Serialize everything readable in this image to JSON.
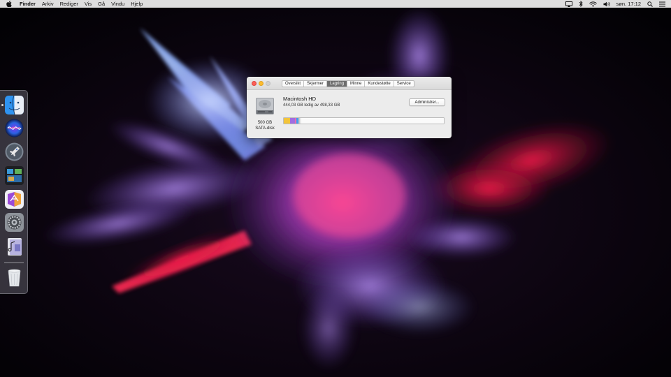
{
  "menubar": {
    "app_name": "Finder",
    "menus": [
      "Arkiv",
      "Rediger",
      "Vis",
      "Gå",
      "Vindu",
      "Hjelp"
    ],
    "clock": "søn. 17:12",
    "status_icons": [
      "airplay-icon",
      "bluetooth-icon",
      "wifi-icon",
      "volume-icon",
      "search-icon",
      "menu-list-icon"
    ]
  },
  "window": {
    "tabs": [
      {
        "label": "Oversikt",
        "active": false
      },
      {
        "label": "Skjermer",
        "active": false
      },
      {
        "label": "Lagring",
        "active": true
      },
      {
        "label": "Minne",
        "active": false
      },
      {
        "label": "Kundestøtte",
        "active": false
      },
      {
        "label": "Service",
        "active": false
      }
    ],
    "disk": {
      "size": "500 GB",
      "type": "SATA-disk"
    },
    "volume": {
      "name": "Macintosh HD",
      "free_text": "444,03 GB ledig av 498,33 GB",
      "used_fraction": 0.109
    },
    "manage_label": "Administrer..."
  },
  "dock": {
    "apps": [
      "finder-icon",
      "siri-icon",
      "launchpad-icon",
      "mission-control-icon",
      "app-store-icon",
      "system-preferences-icon",
      "music-app-icon"
    ],
    "trash": "trash-icon"
  },
  "colors": {
    "usage_segments": [
      "#f3c43a",
      "#a06de0",
      "#e86bb0",
      "#3e9ff2",
      "#bfbfbf"
    ],
    "active_tab": "#6d6d6d"
  }
}
